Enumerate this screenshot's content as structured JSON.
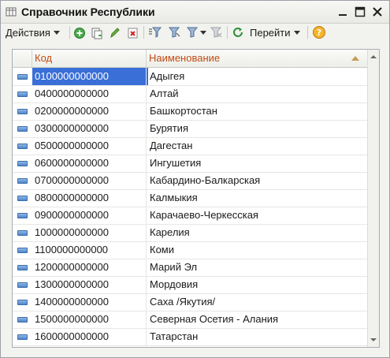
{
  "window": {
    "title": "Справочник Республики"
  },
  "toolbar": {
    "actions_label": "Действия",
    "goto_label": "Перейти"
  },
  "grid": {
    "columns": [
      "Код",
      "Наименование"
    ],
    "rows": [
      {
        "code": "0100000000000",
        "name": "Адыгея"
      },
      {
        "code": "0400000000000",
        "name": "Алтай"
      },
      {
        "code": "0200000000000",
        "name": "Башкортостан"
      },
      {
        "code": "0300000000000",
        "name": "Бурятия"
      },
      {
        "code": "0500000000000",
        "name": "Дагестан"
      },
      {
        "code": "0600000000000",
        "name": "Ингушетия"
      },
      {
        "code": "0700000000000",
        "name": "Кабардино-Балкарская"
      },
      {
        "code": "0800000000000",
        "name": "Калмыкия"
      },
      {
        "code": "0900000000000",
        "name": "Карачаево-Черкесская"
      },
      {
        "code": "1000000000000",
        "name": "Карелия"
      },
      {
        "code": "1100000000000",
        "name": "Коми"
      },
      {
        "code": "1200000000000",
        "name": "Марий Эл"
      },
      {
        "code": "1300000000000",
        "name": "Мордовия"
      },
      {
        "code": "1400000000000",
        "name": "Саха /Якутия/"
      },
      {
        "code": "1500000000000",
        "name": "Северная Осетия - Алания"
      },
      {
        "code": "1600000000000",
        "name": "Татарстан"
      }
    ],
    "selected_index": 0
  },
  "colors": {
    "selection": "#3a6fd8",
    "header_text": "#c04a12"
  }
}
